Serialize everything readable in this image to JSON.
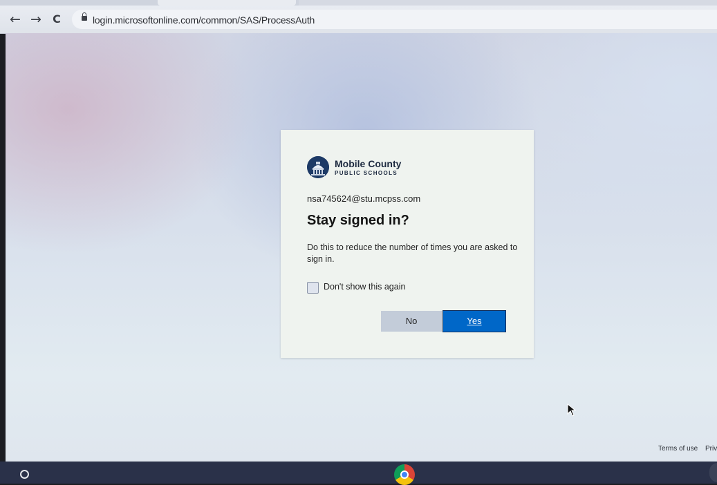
{
  "browser": {
    "url": "login.microsoftonline.com/common/SAS/ProcessAuth",
    "back_icon": "←",
    "forward_icon": "→",
    "reload_icon": "C"
  },
  "dialog": {
    "org_name": "Mobile County",
    "org_sub": "PUBLIC SCHOOLS",
    "email": "nsa745624@stu.mcpss.com",
    "title": "Stay signed in?",
    "description": "Do this to reduce the number of times you are asked to sign in.",
    "checkbox_label": "Don't show this again",
    "checkbox_checked": false,
    "no_label": "No",
    "yes_label": "Yes",
    "accent_color": "#0067c8"
  },
  "footer": {
    "terms": "Terms of use",
    "privacy": "Priv"
  }
}
